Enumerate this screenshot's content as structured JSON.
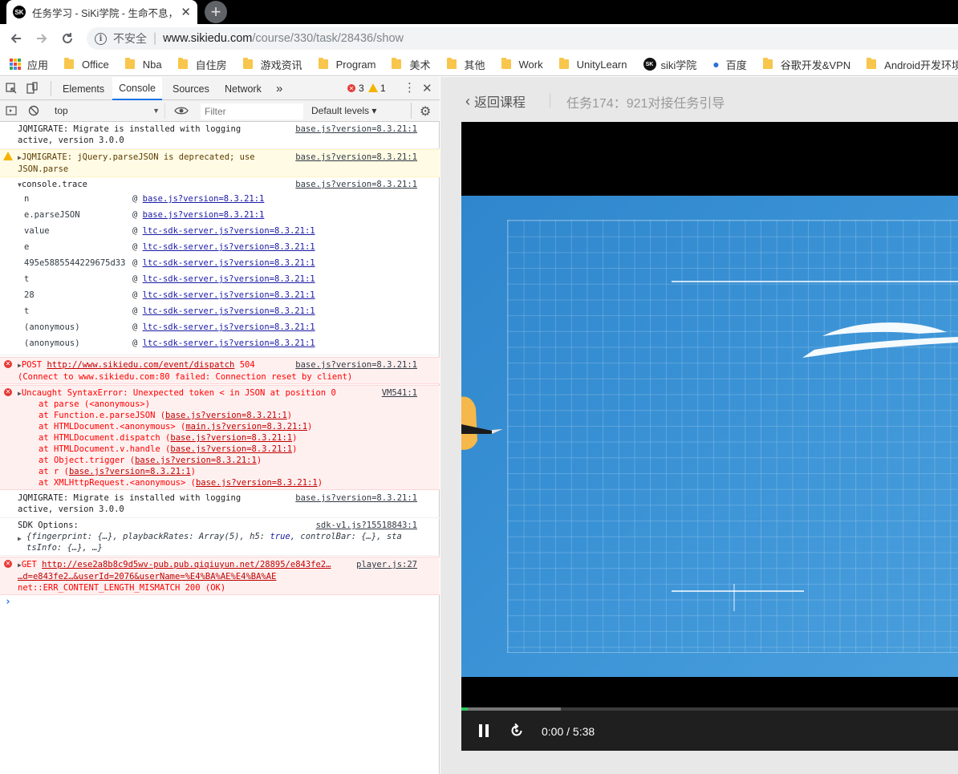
{
  "browser": {
    "tab_title": "任务学习 - SiKi学院 - 生命不息，",
    "tab_favicon": "SK",
    "newtab_label": "+",
    "security_label": "不安全",
    "url_host": "www.sikiedu.com",
    "url_path": "/course/330/task/28436/show"
  },
  "bookmarks": [
    {
      "label": "应用",
      "icon": "apps-grid-icon"
    },
    {
      "label": "Office",
      "icon": "folder-icon"
    },
    {
      "label": "Nba",
      "icon": "folder-icon"
    },
    {
      "label": "自住房",
      "icon": "folder-icon"
    },
    {
      "label": "游戏资讯",
      "icon": "folder-icon"
    },
    {
      "label": "Program",
      "icon": "folder-icon"
    },
    {
      "label": "美术",
      "icon": "folder-icon"
    },
    {
      "label": "其他",
      "icon": "folder-icon"
    },
    {
      "label": "Work",
      "icon": "folder-icon"
    },
    {
      "label": "UnityLearn",
      "icon": "folder-icon"
    },
    {
      "label": "siki学院",
      "icon": "siki-logo-icon"
    },
    {
      "label": "百度",
      "icon": "baidu-paw-icon"
    },
    {
      "label": "谷歌开发&VPN",
      "icon": "folder-icon"
    },
    {
      "label": "Android开发环境",
      "icon": "folder-icon"
    }
  ],
  "devtools": {
    "tabs": [
      "Elements",
      "Console",
      "Sources",
      "Network"
    ],
    "active_tab": "Console",
    "more_tabs": "»",
    "error_count": "3",
    "warning_count": "1",
    "context": "top",
    "filter_placeholder": "Filter",
    "levels": "Default levels ▾"
  },
  "console": {
    "msg1": {
      "text": "JQMIGRATE: Migrate is installed with logging\nactive, version 3.0.0",
      "source": "base.js?version=8.3.21:1"
    },
    "msg2": {
      "text": "JQMIGRATE: jQuery.parseJSON is deprecated; use\nJSON.parse",
      "source": "base.js?version=8.3.21:1"
    },
    "msg3": {
      "text": "console.trace",
      "source": "base.js?version=8.3.21:1"
    },
    "trace": [
      {
        "fn": "n",
        "at": "base.js?version=8.3.21:1"
      },
      {
        "fn": "e.parseJSON",
        "at": "base.js?version=8.3.21:1"
      },
      {
        "fn": "value",
        "at": "ltc-sdk-server.js?version=8.3.21:1"
      },
      {
        "fn": "e",
        "at": "ltc-sdk-server.js?version=8.3.21:1"
      },
      {
        "fn": "495e5885544229675d33",
        "at": "ltc-sdk-server.js?version=8.3.21:1"
      },
      {
        "fn": "t",
        "at": "ltc-sdk-server.js?version=8.3.21:1"
      },
      {
        "fn": "28",
        "at": "ltc-sdk-server.js?version=8.3.21:1"
      },
      {
        "fn": "t",
        "at": "ltc-sdk-server.js?version=8.3.21:1"
      },
      {
        "fn": "(anonymous)",
        "at": "ltc-sdk-server.js?version=8.3.21:1"
      },
      {
        "fn": "(anonymous)",
        "at": "ltc-sdk-server.js?version=8.3.21:1"
      }
    ],
    "err1": {
      "method": "POST",
      "url": "http://www.sikiedu.com/event/dispatch",
      "status": "504",
      "detail": "(Connect to www.sikiedu.com:80 failed: Connection reset by client)",
      "source": "base.js?version=8.3.21:1"
    },
    "err2": {
      "text": "Uncaught SyntaxError: Unexpected token < in JSON at position 0",
      "source": "VM541:1",
      "stack": [
        {
          "pre": "at parse (<anonymous>)",
          "link": "",
          "post": ""
        },
        {
          "pre": "at Function.e.parseJSON (",
          "link": "base.js?version=8.3.21:1",
          "post": ")"
        },
        {
          "pre": "at HTMLDocument.<anonymous> (",
          "link": "main.js?version=8.3.21:1",
          "post": ")"
        },
        {
          "pre": "at HTMLDocument.dispatch (",
          "link": "base.js?version=8.3.21:1",
          "post": ")"
        },
        {
          "pre": "at HTMLDocument.v.handle (",
          "link": "base.js?version=8.3.21:1",
          "post": ")"
        },
        {
          "pre": "at Object.trigger (",
          "link": "base.js?version=8.3.21:1",
          "post": ")"
        },
        {
          "pre": "at r (",
          "link": "base.js?version=8.3.21:1",
          "post": ")"
        },
        {
          "pre": "at XMLHttpRequest.<anonymous> (",
          "link": "base.js?version=8.3.21:1",
          "post": ")"
        }
      ]
    },
    "msg4": {
      "text": "JQMIGRATE: Migrate is installed with logging\nactive, version 3.0.0",
      "source": "base.js?version=8.3.21:1"
    },
    "msg5": {
      "label": "SDK Options:",
      "obj_a": "{fingerprint: {…}, playbackRates: Array(5), h5: ",
      "obj_true": "true",
      "obj_b": ", controlBar: {…}, sta",
      "obj_c": "tsInfo: {…}, …}",
      "source": "sdk-v1.js?15518843:1"
    },
    "err3": {
      "method": "GET",
      "url1": "http://ese2a8b8c9d5wv-pub.pub.qiqiuyun.net/28895/e843fe2…",
      "url2": "…d=e843fe2…&userId=2076&userName=%E4%BA%AE%E4%BA%AE",
      "detail": "net::ERR_CONTENT_LENGTH_MISMATCH 200 (OK)",
      "source": "player.js:27"
    },
    "prompt": "›"
  },
  "course": {
    "back_label": "返回课程",
    "task_title": "任务174：921对接任务引导"
  },
  "player": {
    "current_time": "0:00",
    "duration": "5:38",
    "time_sep": " / ",
    "buffered_fraction": 0.2,
    "played_fraction": 0.0
  },
  "colors": {
    "accent": "#1a73e8",
    "error": "#e53935",
    "warning": "#f4b400",
    "video_blue": "#3b93d6"
  }
}
